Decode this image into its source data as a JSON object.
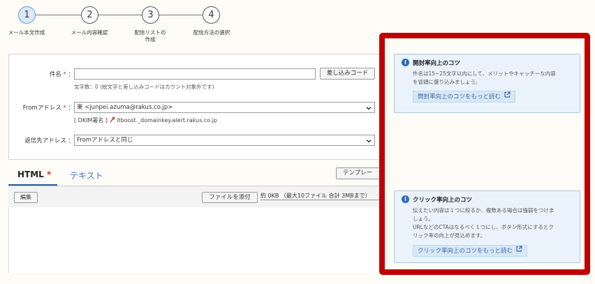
{
  "stepper": {
    "steps": [
      {
        "number": "1",
        "label": "メール本文作成"
      },
      {
        "number": "2",
        "label": "メール内容確認"
      },
      {
        "number": "3",
        "label": "配信リストの\n作成"
      },
      {
        "number": "4",
        "label": "配信方法の選択"
      }
    ]
  },
  "form": {
    "subject": {
      "label": "件名",
      "required_mark": "*",
      "colon": "：",
      "value": "",
      "insert_button": "差し込みコード",
      "counter": "文字数：0 (絵文字と差し込みコードはカウント対象外です)"
    },
    "from": {
      "label": "Fromアドレス",
      "required_mark": "*",
      "colon": "：",
      "value": "東 <junpei.azuma@rakus.co.jp>",
      "dkim": "[ DKIM署名 ] ",
      "dkim_domain": "itboost._domainkey.alert.rakus.co.jp"
    },
    "reply": {
      "label": "返信先アドレス",
      "colon": "：",
      "value": "Fromアドレスと同じ"
    }
  },
  "tabs": {
    "html_label": "HTML",
    "html_required": "*",
    "text_label": "テキスト",
    "template_button": "テンプレー"
  },
  "editor": {
    "edit_button": "編集",
    "attach_button": "ファイルを添付",
    "attach_info": "約 0KB （最大10ファイル 合計 3MBまで）"
  },
  "tips": {
    "open": {
      "title": "開封率向上のコツ",
      "body_line1": "件名は15~25文字以内にして、メリットやキャッチーな内容",
      "body_line2": "を冒頭に盛り込みましょう。",
      "link": "開封率向上のコツをもっと読む"
    },
    "click": {
      "title": "クリック率向上のコツ",
      "body_line1": "伝えたい内容は１つに絞るか、複数ある場合は強弱をつけま",
      "body_line2": "しょう。",
      "body_line3": "URLなどのCTAはなるべく１つにし、ボタン形式にするとク",
      "body_line4": "リック率の向上が見込めます。",
      "link": "クリック率向上のコツをもっと読む"
    },
    "accent_color": "#c00000"
  }
}
